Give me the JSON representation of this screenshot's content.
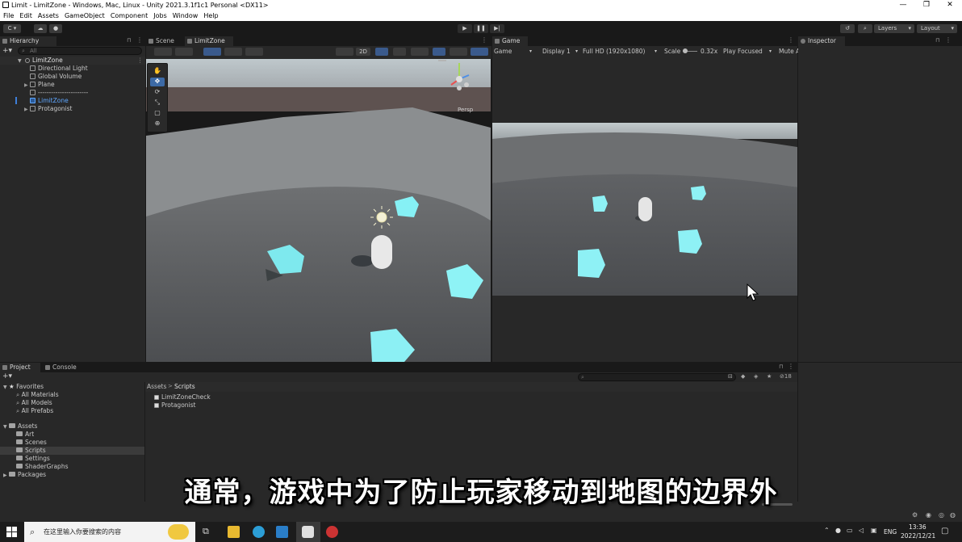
{
  "window": {
    "title": "Limit - LimitZone - Windows, Mac, Linux - Unity 2021.3.1f1c1 Personal <DX11>",
    "minimize": "—",
    "restore": "❐",
    "close": "✕"
  },
  "menu": [
    "File",
    "Edit",
    "Assets",
    "GameObject",
    "Component",
    "Jobs",
    "Window",
    "Help"
  ],
  "toolbar": {
    "account_label": "C",
    "layers_label": "Layers",
    "layout_label": "Layout",
    "play": "▶",
    "pause": "❚❚",
    "step": "▶|"
  },
  "hierarchy": {
    "tab": "Hierarchy",
    "search_placeholder": "All",
    "scene_root": "LimitZone",
    "items": [
      {
        "label": "Directional Light"
      },
      {
        "label": "Global Volume"
      },
      {
        "label": "Plane"
      },
      {
        "label": "-----------------------"
      },
      {
        "label": "LimitZone"
      },
      {
        "label": "Protagonist"
      }
    ]
  },
  "scene": {
    "tab_scene": "Scene",
    "tab_limitzone": "LimitZone",
    "btn_2d": "2D",
    "persp_label": "Persp"
  },
  "game": {
    "tab": "Game",
    "display_mode": "Game",
    "display": "Display 1",
    "resolution": "Full HD (1920x1080)",
    "scale_label": "Scale",
    "scale_value": "0.32x",
    "play_focused": "Play Focused",
    "mute": "Mute A"
  },
  "inspector": {
    "tab": "Inspector"
  },
  "project": {
    "tab_project": "Project",
    "tab_console": "Console",
    "hidden_count": "18",
    "favorites_label": "Favorites",
    "favorites": [
      "All Materials",
      "All Models",
      "All Prefabs"
    ],
    "assets_label": "Assets",
    "asset_folders": [
      "Art",
      "Scenes",
      "Scripts",
      "Settings",
      "ShaderGraphs"
    ],
    "packages_label": "Packages",
    "breadcrumb_root": "Assets",
    "breadcrumb_sep": ">",
    "breadcrumb_current": "Scripts",
    "files": [
      "LimitZoneCheck",
      "Protagonist"
    ]
  },
  "subtitle": "通常，游戏中为了防止玩家移动到地图的边界外",
  "taskbar": {
    "search_placeholder": "在这里输入你要搜索的内容",
    "lang": "ENG",
    "time": "13:36",
    "date": "2022/12/21"
  }
}
